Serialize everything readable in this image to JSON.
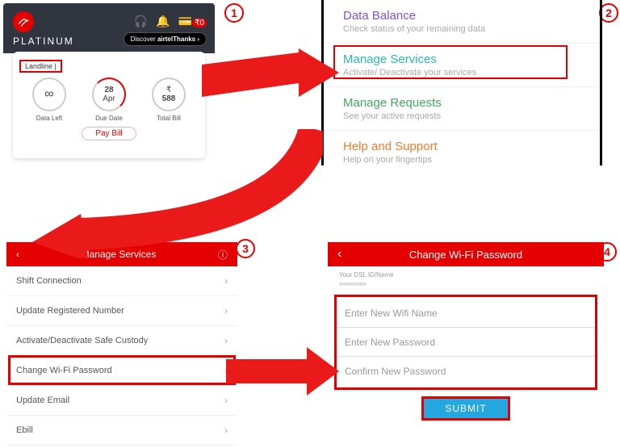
{
  "steps": {
    "1": "1",
    "2": "2",
    "3": "3",
    "4": "4"
  },
  "p1": {
    "plan": "PLATINUM",
    "badge_prefix": "Discover",
    "badge_brand": "airtelThanks ›",
    "landline_label": "Landline |",
    "data_left_symbol": "∞",
    "data_left_label": "Data Left",
    "due_day": "28",
    "due_month": "Apr",
    "due_label": "Due Date",
    "bill_currency": "₹",
    "bill_amount": "588",
    "bill_label": "Total Bill",
    "pay_bill": "Pay Bill",
    "wallet_amount": "₹0"
  },
  "p2": {
    "items": [
      {
        "title": "Data Balance",
        "sub": "Check status of your remaining data"
      },
      {
        "title": "Manage Services",
        "sub": "Activate/ Deactivate your services"
      },
      {
        "title": "Manage Requests",
        "sub": "See your active requests"
      },
      {
        "title": "Help and Support",
        "sub": "Help on your fingertips"
      }
    ]
  },
  "p3": {
    "header": "Manage Services",
    "rows": [
      "Shift Connection",
      "Update Registered Number",
      "Activate/Deactivate Safe Custody",
      "Change Wi-Fi Password",
      "Update Email",
      "Ebill"
    ]
  },
  "p4": {
    "header": "Change Wi-Fi Password",
    "dsl_label": "Your DSL ID/Name",
    "dsl_value": "••••••••",
    "fields": {
      "wifi_name": "Enter New Wifi Name",
      "new_pw": "Enter New Password",
      "confirm_pw": "Confirm New Password"
    },
    "submit": "SUBMIT"
  }
}
